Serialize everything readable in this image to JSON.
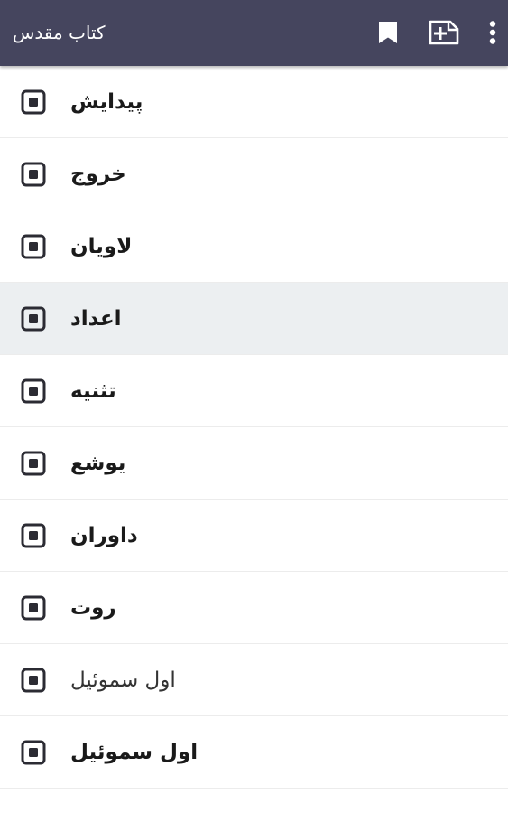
{
  "app": {
    "title": "کتاب مقدس"
  },
  "toolbar": {
    "bookmark_icon": "bookmark-icon",
    "add_note_icon": "note-add-icon",
    "more_icon": "more-vertical-icon"
  },
  "books": [
    {
      "label": "پیدایش",
      "selected": false
    },
    {
      "label": "خروج",
      "selected": false
    },
    {
      "label": "لاویان",
      "selected": false
    },
    {
      "label": "اعداد",
      "selected": true
    },
    {
      "label": "تثنیه",
      "selected": false
    },
    {
      "label": "یوشع",
      "selected": false
    },
    {
      "label": "داوران",
      "selected": false
    },
    {
      "label": "روت",
      "selected": false
    },
    {
      "label": "اول سموئیل",
      "selected": false
    },
    {
      "label": "اول سموئیل",
      "selected": false
    }
  ],
  "colors": {
    "toolbar": "#45455e",
    "selected_row": "#eceff1",
    "icon": "#2b2b33"
  }
}
